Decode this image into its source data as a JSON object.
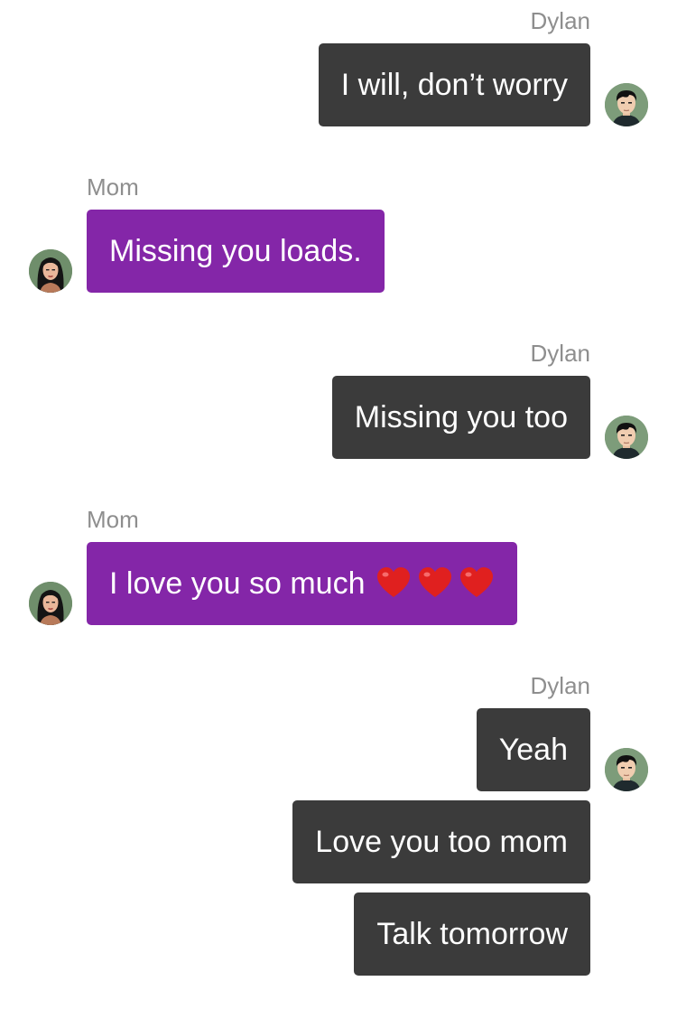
{
  "conversation": {
    "groups": [
      {
        "sender": "Dylan",
        "messages": [
          "I will, don’t worry"
        ]
      },
      {
        "sender": "Mom",
        "messages": [
          "Missing you loads."
        ]
      },
      {
        "sender": "Dylan",
        "messages": [
          "Missing you too"
        ]
      },
      {
        "sender": "Mom",
        "messages": [
          "I love you so much"
        ],
        "emoji": [
          "heart",
          "heart",
          "heart"
        ]
      },
      {
        "sender": "Dylan",
        "messages": [
          "Yeah",
          "Love you too mom",
          "Talk tomorrow"
        ]
      }
    ]
  },
  "colors": {
    "dylan_bubble": "#3b3b3b",
    "mom_bubble": "#8426a8",
    "sender_name": "#8e8e8e",
    "heart": "#e0201f"
  },
  "icons": {
    "dylan_avatar": "avatar-young-man-dark-hair",
    "mom_avatar": "avatar-woman-dark-hair",
    "emoji": "red-heart-icon"
  }
}
